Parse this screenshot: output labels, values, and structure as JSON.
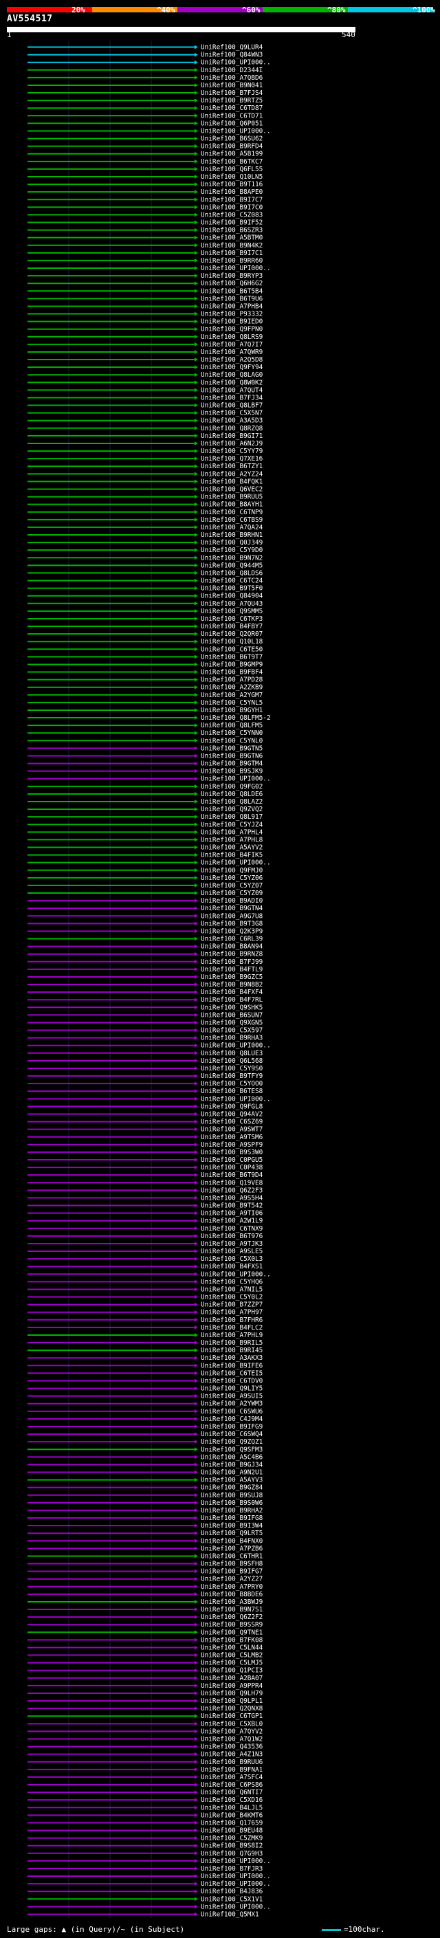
{
  "legend": {
    "segments": [
      {
        "color": "#ff0000",
        "label": "20%"
      },
      {
        "color": "#ff8c00",
        "label": "^40%"
      },
      {
        "color": "#a000c8",
        "label": "^60%"
      },
      {
        "color": "#00b400",
        "label": "^80%"
      },
      {
        "color": "#00c8e6",
        "label": "^100%"
      }
    ]
  },
  "query": {
    "name": "AV554517",
    "start": "1",
    "end": "540"
  },
  "hits": [
    {
      "label": "UniRef100_Q9LUR4",
      "color": "#00c8e6"
    },
    {
      "label": "UniRef100_Q84WN3",
      "color": "#00c8e6"
    },
    {
      "label": "UniRef100_UPI000..",
      "color": "#00c8e6"
    },
    {
      "label": "UniRef100_D2344I",
      "color": "#00b400"
    },
    {
      "label": "UniRef100_A7QBD6",
      "color": "#00b400"
    },
    {
      "label": "UniRef100_B9N041",
      "color": "#00b400"
    },
    {
      "label": "UniRef100_B7FJS4",
      "color": "#00b400"
    },
    {
      "label": "UniRef100_B9RTZ5",
      "color": "#00b400"
    },
    {
      "label": "UniRef100_C6TD87",
      "color": "#00b400"
    },
    {
      "label": "UniRef100_C6TD71",
      "color": "#00b400"
    },
    {
      "label": "UniRef100_Q6P051",
      "color": "#00b400"
    },
    {
      "label": "UniRef100_UPI000..",
      "color": "#00b400"
    },
    {
      "label": "UniRef100_B6SU62",
      "color": "#00b400"
    },
    {
      "label": "UniRef100_B9RFD4",
      "color": "#00b400"
    },
    {
      "label": "UniRef100_A5B199",
      "color": "#00b400"
    },
    {
      "label": "UniRef100_B6TKC7",
      "color": "#00b400"
    },
    {
      "label": "UniRef100_Q6FL55",
      "color": "#00b400"
    },
    {
      "label": "UniRef100_Q10LN5",
      "color": "#00b400"
    },
    {
      "label": "UniRef100_B9T116",
      "color": "#00b400"
    },
    {
      "label": "UniRef100_B8APE0",
      "color": "#00b400"
    },
    {
      "label": "UniRef100_B9I7C7",
      "color": "#00b400"
    },
    {
      "label": "UniRef100_B9I7C0",
      "color": "#00b400"
    },
    {
      "label": "UniRef100_C5Z083",
      "color": "#00b400"
    },
    {
      "label": "UniRef100_B9IF52",
      "color": "#00b400"
    },
    {
      "label": "UniRef100_B6SZR3",
      "color": "#00b400"
    },
    {
      "label": "UniRef100_A5BTM0",
      "color": "#00b400"
    },
    {
      "label": "UniRef100_B9N4K2",
      "color": "#00b400"
    },
    {
      "label": "UniRef100_B9I7C1",
      "color": "#00b400"
    },
    {
      "label": "UniRef100_B9RR60",
      "color": "#00b400"
    },
    {
      "label": "UniRef100_UPI000..",
      "color": "#00b400"
    },
    {
      "label": "UniRef100_B9RYP3",
      "color": "#00b400"
    },
    {
      "label": "UniRef100_Q6H6G2",
      "color": "#00b400"
    },
    {
      "label": "UniRef100_B6T5B4",
      "color": "#00b400"
    },
    {
      "label": "UniRef100_B6T9U6",
      "color": "#00b400"
    },
    {
      "label": "UniRef100_A7PHB4",
      "color": "#00b400"
    },
    {
      "label": "UniRef100_P93332",
      "color": "#00b400"
    },
    {
      "label": "UniRef100_B9IED0",
      "color": "#00b400"
    },
    {
      "label": "UniRef100_Q9FPN0",
      "color": "#00b400"
    },
    {
      "label": "UniRef100_Q8LRS9",
      "color": "#00b400"
    },
    {
      "label": "UniRef100_A7Q7I7",
      "color": "#00b400"
    },
    {
      "label": "UniRef100_A7QWR9",
      "color": "#00b400"
    },
    {
      "label": "UniRef100_A2Q5D8",
      "color": "#00b400"
    },
    {
      "label": "UniRef100_Q9FY94",
      "color": "#00b400"
    },
    {
      "label": "UniRef100_Q8LAG0",
      "color": "#00b400"
    },
    {
      "label": "UniRef100_Q8W0K2",
      "color": "#00b400"
    },
    {
      "label": "UniRef100_A7QUT4",
      "color": "#00b400"
    },
    {
      "label": "UniRef100_B7FJ34",
      "color": "#00b400"
    },
    {
      "label": "UniRef100_Q8LBF7",
      "color": "#00b400"
    },
    {
      "label": "UniRef100_C5X5N7",
      "color": "#00b400"
    },
    {
      "label": "UniRef100_A3A5D3",
      "color": "#00b400"
    },
    {
      "label": "UniRef100_Q8RZQ8",
      "color": "#00b400"
    },
    {
      "label": "UniRef100_B9GI71",
      "color": "#00b400"
    },
    {
      "label": "UniRef100_A6N2J9",
      "color": "#00b400"
    },
    {
      "label": "UniRef100_C5YY79",
      "color": "#00b400"
    },
    {
      "label": "UniRef100_Q7XE16",
      "color": "#00b400"
    },
    {
      "label": "UniRef100_B6TZY1",
      "color": "#00b400"
    },
    {
      "label": "UniRef100_A2YZ24",
      "color": "#00b400"
    },
    {
      "label": "UniRef100_B4FQK1",
      "color": "#00b400"
    },
    {
      "label": "UniRef100_Q6VEC2",
      "color": "#00b400"
    },
    {
      "label": "UniRef100_B9RUU5",
      "color": "#00b400"
    },
    {
      "label": "UniRef100_B8AYH1",
      "color": "#00b400"
    },
    {
      "label": "UniRef100_C6TNP9",
      "color": "#00b400"
    },
    {
      "label": "UniRef100_C6TBS9",
      "color": "#00b400"
    },
    {
      "label": "UniRef100_A7QA24",
      "color": "#00b400"
    },
    {
      "label": "UniRef100_B9RHN1",
      "color": "#00b400"
    },
    {
      "label": "UniRef100_Q0J349",
      "color": "#00b400"
    },
    {
      "label": "UniRef100_C5Y9D0",
      "color": "#00b400"
    },
    {
      "label": "UniRef100_B9N7N2",
      "color": "#00b400"
    },
    {
      "label": "UniRef100_Q944M5",
      "color": "#00b400"
    },
    {
      "label": "UniRef100_Q8LDS6",
      "color": "#00b400"
    },
    {
      "label": "UniRef100_C6TC24",
      "color": "#00b400"
    },
    {
      "label": "UniRef100_B9T5F0",
      "color": "#00b400"
    },
    {
      "label": "UniRef100_Q84904",
      "color": "#00b400"
    },
    {
      "label": "UniRef100_A7QU43",
      "color": "#00b400"
    },
    {
      "label": "UniRef100_Q9SMM5",
      "color": "#00b400"
    },
    {
      "label": "UniRef100_C6TKP3",
      "color": "#00b400"
    },
    {
      "label": "UniRef100_B4FBY7",
      "color": "#00b400"
    },
    {
      "label": "UniRef100_Q2QR07",
      "color": "#00b400"
    },
    {
      "label": "UniRef100_Q10L18",
      "color": "#00b400"
    },
    {
      "label": "UniRef100_C6TE50",
      "color": "#00b400"
    },
    {
      "label": "UniRef100_B6T9T7",
      "color": "#00b400"
    },
    {
      "label": "UniRef100_B9GMP9",
      "color": "#00b400"
    },
    {
      "label": "UniRef100_B9FBF4",
      "color": "#00b400"
    },
    {
      "label": "UniRef100_A7PD28",
      "color": "#00b400"
    },
    {
      "label": "UniRef100_A2ZKB9",
      "color": "#00b400"
    },
    {
      "label": "UniRef100_A2YGM7",
      "color": "#00b400"
    },
    {
      "label": "UniRef100_C5YNL5",
      "color": "#00b400"
    },
    {
      "label": "UniRef100_B9GYH1",
      "color": "#00b400"
    },
    {
      "label": "UniRef100_Q8LFM5-2",
      "color": "#00b400"
    },
    {
      "label": "UniRef100_Q8LFM5",
      "color": "#00b400"
    },
    {
      "label": "UniRef100_C5YNN0",
      "color": "#00b400"
    },
    {
      "label": "UniRef100_C5YNL0",
      "color": "#00b400"
    },
    {
      "label": "UniRef100_B9GTN5",
      "color": "#a000c8"
    },
    {
      "label": "UniRef100_B9GTN6",
      "color": "#a000c8"
    },
    {
      "label": "UniRef100_B9GTM4",
      "color": "#a000c8"
    },
    {
      "label": "UniRef100_B9SJK9",
      "color": "#a000c8"
    },
    {
      "label": "UniRef100_UPI000..",
      "color": "#a000c8"
    },
    {
      "label": "UniRef100_Q9FG02",
      "color": "#00b400"
    },
    {
      "label": "UniRef100_Q8LDE6",
      "color": "#00b400"
    },
    {
      "label": "UniRef100_Q8LAZ2",
      "color": "#00b400"
    },
    {
      "label": "UniRef100_Q9ZVQ2",
      "color": "#00b400"
    },
    {
      "label": "UniRef100_Q8L917",
      "color": "#00b400"
    },
    {
      "label": "UniRef100_C5YJZ4",
      "color": "#00b400"
    },
    {
      "label": "UniRef100_A7PHL4",
      "color": "#00b400"
    },
    {
      "label": "UniRef100_A7PHL8",
      "color": "#00b400"
    },
    {
      "label": "UniRef100_A5AYV2",
      "color": "#00b400"
    },
    {
      "label": "UniRef100_B4FIK5",
      "color": "#00b400"
    },
    {
      "label": "UniRef100_UPI000..",
      "color": "#00b400"
    },
    {
      "label": "UniRef100_Q9FMJ0",
      "color": "#00b400"
    },
    {
      "label": "UniRef100_C5YZ06",
      "color": "#00b400"
    },
    {
      "label": "UniRef100_C5YZ07",
      "color": "#00b400"
    },
    {
      "label": "UniRef100_C5YZ09",
      "color": "#00b400"
    },
    {
      "label": "UniRef100_B9ADI0",
      "color": "#a000c8"
    },
    {
      "label": "UniRef100_B9GTN4",
      "color": "#a000c8"
    },
    {
      "label": "UniRef100_A9G7U8",
      "color": "#a000c8"
    },
    {
      "label": "UniRef100_B9T3G8",
      "color": "#a000c8"
    },
    {
      "label": "UniRef100_Q2K3P9",
      "color": "#a000c8"
    },
    {
      "label": "UniRef100_C6RL39",
      "color": "#00b400"
    },
    {
      "label": "UniRef100_B8AN94",
      "color": "#a000c8"
    },
    {
      "label": "UniRef100_B9RNZ8",
      "color": "#a000c8"
    },
    {
      "label": "UniRef100_B7FJ99",
      "color": "#a000c8"
    },
    {
      "label": "UniRef100_B4FTL9",
      "color": "#a000c8"
    },
    {
      "label": "UniRef100_B9GZC5",
      "color": "#a000c8"
    },
    {
      "label": "UniRef100_B9N8B2",
      "color": "#a000c8"
    },
    {
      "label": "UniRef100_B4FXF4",
      "color": "#a000c8"
    },
    {
      "label": "UniRef100_B4F7RL",
      "color": "#a000c8"
    },
    {
      "label": "UniRef100_Q9SHK5",
      "color": "#a000c8"
    },
    {
      "label": "UniRef100_B6SUN7",
      "color": "#a000c8"
    },
    {
      "label": "UniRef100_Q9XGN5",
      "color": "#a000c8"
    },
    {
      "label": "UniRef100_C5X597",
      "color": "#a000c8"
    },
    {
      "label": "UniRef100_B9RHA3",
      "color": "#a000c8"
    },
    {
      "label": "UniRef100_UPI000..",
      "color": "#a000c8"
    },
    {
      "label": "UniRef100_Q8LUE3",
      "color": "#a000c8"
    },
    {
      "label": "UniRef100_Q6L568",
      "color": "#a000c8"
    },
    {
      "label": "UniRef100_C5Y9S0",
      "color": "#a000c8"
    },
    {
      "label": "UniRef100_B9TFY9",
      "color": "#a000c8"
    },
    {
      "label": "UniRef100_C5YOO0",
      "color": "#a000c8"
    },
    {
      "label": "UniRef100_B6TES8",
      "color": "#a000c8"
    },
    {
      "label": "UniRef100_UPI000..",
      "color": "#a000c8"
    },
    {
      "label": "UniRef100_Q9FGL8",
      "color": "#a000c8"
    },
    {
      "label": "UniRef100_Q94AV2",
      "color": "#a000c8"
    },
    {
      "label": "UniRef100_C6SZ69",
      "color": "#a000c8"
    },
    {
      "label": "UniRef100_A9SWT7",
      "color": "#a000c8"
    },
    {
      "label": "UniRef100_A9TSM6",
      "color": "#a000c8"
    },
    {
      "label": "UniRef100_A9SPF9",
      "color": "#a000c8"
    },
    {
      "label": "UniRef100_B9S3W0",
      "color": "#a000c8"
    },
    {
      "label": "UniRef100_C0PGU5",
      "color": "#a000c8"
    },
    {
      "label": "UniRef100_C0P438",
      "color": "#a000c8"
    },
    {
      "label": "UniRef100_B6T9D4",
      "color": "#a000c8"
    },
    {
      "label": "UniRef100_Q19VE8",
      "color": "#a000c8"
    },
    {
      "label": "UniRef100_Q6Z2F3",
      "color": "#a000c8"
    },
    {
      "label": "UniRef100_A9S5H4",
      "color": "#a000c8"
    },
    {
      "label": "UniRef100_B9T542",
      "color": "#a000c8"
    },
    {
      "label": "UniRef100_A9TI06",
      "color": "#a000c8"
    },
    {
      "label": "UniRef100_A2W1L9",
      "color": "#a000c8"
    },
    {
      "label": "UniRef100_C6TNX9",
      "color": "#a000c8"
    },
    {
      "label": "UniRef100_B6T976",
      "color": "#a000c8"
    },
    {
      "label": "UniRef100_A9TJK3",
      "color": "#a000c8"
    },
    {
      "label": "UniRef100_A9SLE5",
      "color": "#a000c8"
    },
    {
      "label": "UniRef100_C5X0L3",
      "color": "#a000c8"
    },
    {
      "label": "UniRef100_B4FXS1",
      "color": "#a000c8"
    },
    {
      "label": "UniRef100_UPI000..",
      "color": "#a000c8"
    },
    {
      "label": "UniRef100_C5YHQ6",
      "color": "#a000c8"
    },
    {
      "label": "UniRef100_A7NIL5",
      "color": "#a000c8"
    },
    {
      "label": "UniRef100_C5Y0L2",
      "color": "#a000c8"
    },
    {
      "label": "UniRef100_B7ZZP7",
      "color": "#a000c8"
    },
    {
      "label": "UniRef100_A7PH97",
      "color": "#a000c8"
    },
    {
      "label": "UniRef100_B7FHR6",
      "color": "#a000c8"
    },
    {
      "label": "UniRef100_B4FLC2",
      "color": "#a000c8"
    },
    {
      "label": "UniRef100_A7PHL9",
      "color": "#00b400"
    },
    {
      "label": "UniRef100_B9RIL5",
      "color": "#a000c8"
    },
    {
      "label": "UniRef100_B9RI45",
      "color": "#00b400"
    },
    {
      "label": "UniRef100_A3AKX3",
      "color": "#a000c8"
    },
    {
      "label": "UniRef100_B9IFE6",
      "color": "#a000c8"
    },
    {
      "label": "UniRef100_C6TEI5",
      "color": "#a000c8"
    },
    {
      "label": "UniRef100_C6TDV0",
      "color": "#a000c8"
    },
    {
      "label": "UniRef100_Q9LIY5",
      "color": "#a000c8"
    },
    {
      "label": "UniRef100_A9SUI5",
      "color": "#a000c8"
    },
    {
      "label": "UniRef100_A2YWM3",
      "color": "#a000c8"
    },
    {
      "label": "UniRef100_C6SWU6",
      "color": "#a000c8"
    },
    {
      "label": "UniRef100_C4J9M4",
      "color": "#a000c8"
    },
    {
      "label": "UniRef100_B9IFG9",
      "color": "#a000c8"
    },
    {
      "label": "UniRef100_C6SWQ4",
      "color": "#a000c8"
    },
    {
      "label": "UniRef100_Q9ZQZ1",
      "color": "#a000c8"
    },
    {
      "label": "UniRef100_Q9SFM3",
      "color": "#00b400"
    },
    {
      "label": "UniRef100_A5C4B6",
      "color": "#a000c8"
    },
    {
      "label": "UniRef100_B9GJ34",
      "color": "#a000c8"
    },
    {
      "label": "UniRef100_A9N2U1",
      "color": "#a000c8"
    },
    {
      "label": "UniRef100_A5AYV3",
      "color": "#00b400"
    },
    {
      "label": "UniRef100_B9GZ84",
      "color": "#a000c8"
    },
    {
      "label": "UniRef100_B9SUJ8",
      "color": "#a000c8"
    },
    {
      "label": "UniRef100_B9S0W6",
      "color": "#a000c8"
    },
    {
      "label": "UniRef100_B9RHA2",
      "color": "#a000c8"
    },
    {
      "label": "UniRef100_B9IFG8",
      "color": "#a000c8"
    },
    {
      "label": "UniRef100_B9I3W4",
      "color": "#a000c8"
    },
    {
      "label": "UniRef100_Q9LRT5",
      "color": "#a000c8"
    },
    {
      "label": "UniRef100_B4FNX0",
      "color": "#a000c8"
    },
    {
      "label": "UniRef100_A7PZB6",
      "color": "#a000c8"
    },
    {
      "label": "UniRef100_C6THR1",
      "color": "#00b400"
    },
    {
      "label": "UniRef100_B9SFH8",
      "color": "#a000c8"
    },
    {
      "label": "UniRef100_B9IFG7",
      "color": "#a000c8"
    },
    {
      "label": "UniRef100_A2YZ27",
      "color": "#a000c8"
    },
    {
      "label": "UniRef100_A7PRY0",
      "color": "#a000c8"
    },
    {
      "label": "UniRef100_B8BDE6",
      "color": "#a000c8"
    },
    {
      "label": "UniRef100_A3BWJ9",
      "color": "#00b400"
    },
    {
      "label": "UniRef100_B9N7S1",
      "color": "#a000c8"
    },
    {
      "label": "UniRef100_Q6Z2F2",
      "color": "#a000c8"
    },
    {
      "label": "UniRef100_B9SSR9",
      "color": "#a000c8"
    },
    {
      "label": "UniRef100_Q9TNE1",
      "color": "#00b400"
    },
    {
      "label": "UniRef100_B7FK08",
      "color": "#a000c8"
    },
    {
      "label": "UniRef100_C5LN44",
      "color": "#a000c8"
    },
    {
      "label": "UniRef100_C5LMB2",
      "color": "#a000c8"
    },
    {
      "label": "UniRef100_C5LMJ5",
      "color": "#a000c8"
    },
    {
      "label": "UniRef100_Q1PCI3",
      "color": "#a000c8"
    },
    {
      "label": "UniRef100_A2BA07",
      "color": "#a000c8"
    },
    {
      "label": "UniRef100_A9PPR4",
      "color": "#a000c8"
    },
    {
      "label": "UniRef100_Q9LH79",
      "color": "#a000c8"
    },
    {
      "label": "UniRef100_Q9LPL1",
      "color": "#a000c8"
    },
    {
      "label": "UniRef100_Q2QNX8",
      "color": "#a000c8"
    },
    {
      "label": "UniRef100_C6TGP1",
      "color": "#00b400"
    },
    {
      "label": "UniRef100_C5XBL0",
      "color": "#a000c8"
    },
    {
      "label": "UniRef100_A7QYV2",
      "color": "#a000c8"
    },
    {
      "label": "UniRef100_A7Q1W2",
      "color": "#a000c8"
    },
    {
      "label": "UniRef100_Q43536",
      "color": "#a000c8"
    },
    {
      "label": "UniRef100_A4Z1N3",
      "color": "#a000c8"
    },
    {
      "label": "UniRef100_B9RUU6",
      "color": "#a000c8"
    },
    {
      "label": "UniRef100_B9FNA1",
      "color": "#a000c8"
    },
    {
      "label": "UniRef100_A7SFC4",
      "color": "#a000c8"
    },
    {
      "label": "UniRef100_C6PS86",
      "color": "#a000c8"
    },
    {
      "label": "UniRef100_Q6NTI7",
      "color": "#a000c8"
    },
    {
      "label": "UniRef100_C5XD16",
      "color": "#a000c8"
    },
    {
      "label": "UniRef100_B4LJL5",
      "color": "#a000c8"
    },
    {
      "label": "UniRef100_B4KMT6",
      "color": "#a000c8"
    },
    {
      "label": "UniRef100_Q17659",
      "color": "#a000c8"
    },
    {
      "label": "UniRef100_B9EU48",
      "color": "#a000c8"
    },
    {
      "label": "UniRef100_C5ZMK9",
      "color": "#a000c8"
    },
    {
      "label": "UniRef100_B9S8I2",
      "color": "#a000c8"
    },
    {
      "label": "UniRef100_Q7G9H3",
      "color": "#a000c8"
    },
    {
      "label": "UniRef100_UPI000..",
      "color": "#a000c8"
    },
    {
      "label": "UniRef100_B7FJR3",
      "color": "#a000c8"
    },
    {
      "label": "UniRef100_UPI000..",
      "color": "#a000c8"
    },
    {
      "label": "UniRef100_UPI000..",
      "color": "#a000c8"
    },
    {
      "label": "UniRef100_B4J836",
      "color": "#a000c8"
    },
    {
      "label": "UniRef100_C5X1V1",
      "color": "#00b400"
    },
    {
      "label": "UniRef100_UPI000..",
      "color": "#a000c8"
    },
    {
      "label": "UniRef100_Q5MX1",
      "color": "#a000c8"
    }
  ],
  "footer": {
    "gaps_text": "Large gaps: ▲ (in Query)/~ (in Subject)",
    "scale_text": "=100char."
  }
}
